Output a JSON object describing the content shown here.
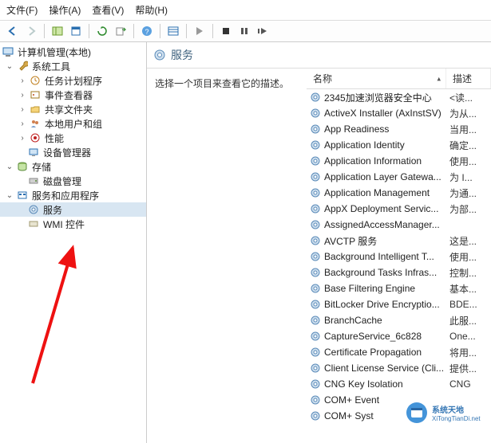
{
  "menu": {
    "file": "文件(F)",
    "action": "操作(A)",
    "view": "查看(V)",
    "help": "帮助(H)"
  },
  "tree": {
    "root": "计算机管理(本地)",
    "system_tools": "系统工具",
    "task_scheduler": "任务计划程序",
    "event_viewer": "事件查看器",
    "shared_folders": "共享文件夹",
    "local_users": "本地用户和组",
    "performance": "性能",
    "device_manager": "设备管理器",
    "storage": "存储",
    "disk_mgmt": "磁盘管理",
    "services_apps": "服务和应用程序",
    "services": "服务",
    "wmi_control": "WMI 控件"
  },
  "detail": {
    "title": "服务",
    "prompt": "选择一个项目来查看它的描述。",
    "col_name": "名称",
    "col_desc": "描述"
  },
  "services_list": [
    {
      "name": "2345加速浏览器安全中心",
      "desc": "<读..."
    },
    {
      "name": "ActiveX Installer (AxInstSV)",
      "desc": "为从..."
    },
    {
      "name": "App Readiness",
      "desc": "当用..."
    },
    {
      "name": "Application Identity",
      "desc": "确定..."
    },
    {
      "name": "Application Information",
      "desc": "使用..."
    },
    {
      "name": "Application Layer Gatewa...",
      "desc": "为 I..."
    },
    {
      "name": "Application Management",
      "desc": "为通..."
    },
    {
      "name": "AppX Deployment Servic...",
      "desc": "为部..."
    },
    {
      "name": "AssignedAccessManager...",
      "desc": ""
    },
    {
      "name": "AVCTP 服务",
      "desc": "这是..."
    },
    {
      "name": "Background Intelligent T...",
      "desc": "使用..."
    },
    {
      "name": "Background Tasks Infras...",
      "desc": "控制..."
    },
    {
      "name": "Base Filtering Engine",
      "desc": "基本..."
    },
    {
      "name": "BitLocker Drive Encryptio...",
      "desc": "BDE..."
    },
    {
      "name": "BranchCache",
      "desc": "此服..."
    },
    {
      "name": "CaptureService_6c828",
      "desc": "One..."
    },
    {
      "name": "Certificate Propagation",
      "desc": "将用..."
    },
    {
      "name": "Client License Service (Cli...",
      "desc": "提供..."
    },
    {
      "name": "CNG Key Isolation",
      "desc": "CNG"
    },
    {
      "name": "COM+ Event",
      "desc": ""
    },
    {
      "name": "COM+ Syst",
      "desc": ""
    }
  ],
  "watermark": {
    "text": "系统天地",
    "sub": "XiTongTianDi.net"
  }
}
